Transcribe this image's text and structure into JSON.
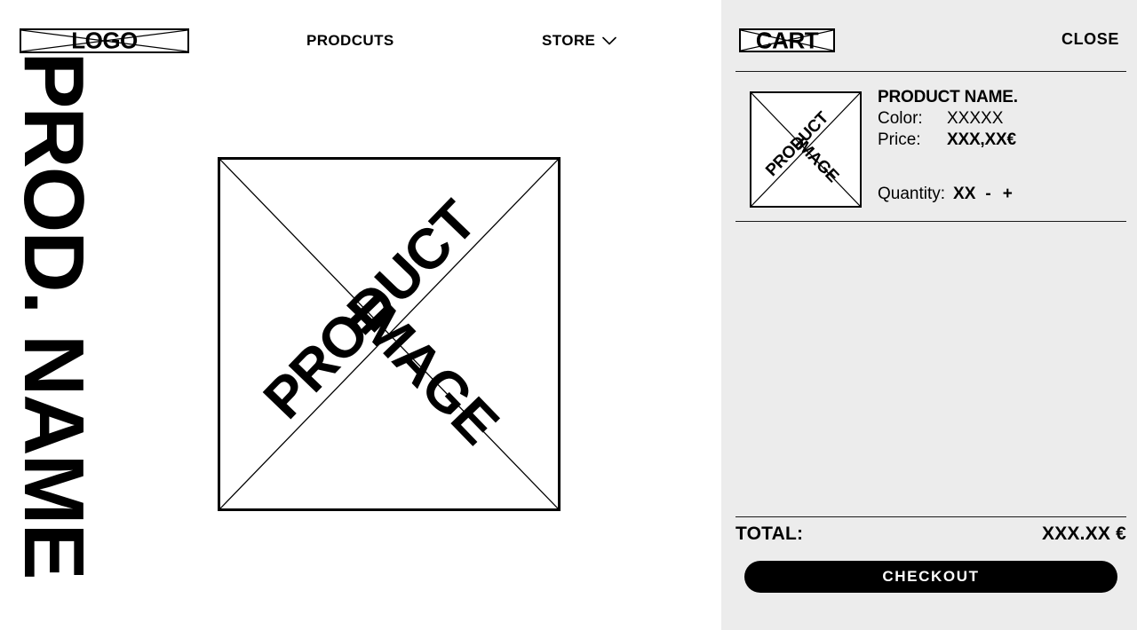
{
  "header": {
    "logo_label": "LOGO",
    "nav": [
      {
        "label": "PRODCUTS",
        "has_chevron": false
      },
      {
        "label": "STORE",
        "has_chevron": true
      }
    ]
  },
  "product_page": {
    "vertical_title": "PROD. NAME",
    "image_placeholder": {
      "word_top": "PRODUCT",
      "word_bottom": "IMAGE"
    }
  },
  "cart": {
    "title": "CART",
    "close_label": "CLOSE",
    "items": [
      {
        "thumb_word_top": "PRODUCT",
        "thumb_word_bottom": "IMAGE",
        "name": "PRODUCT NAME.",
        "color_label": "Color:",
        "color_value": "XXXXX",
        "price_label": "Price:",
        "price_value": "XXX,XX€",
        "quantity_label": "Quantity:",
        "quantity_value": "XX",
        "decrement_label": "-",
        "increment_label": "+"
      }
    ],
    "total_label": "TOTAL:",
    "total_value": "XXX.XX €",
    "checkout_label": "CHECKOUT"
  },
  "colors": {
    "panel_background": "#ececec",
    "page_background": "#ffffff",
    "ink": "#000000",
    "button_background": "#000000",
    "button_text": "#ffffff"
  }
}
